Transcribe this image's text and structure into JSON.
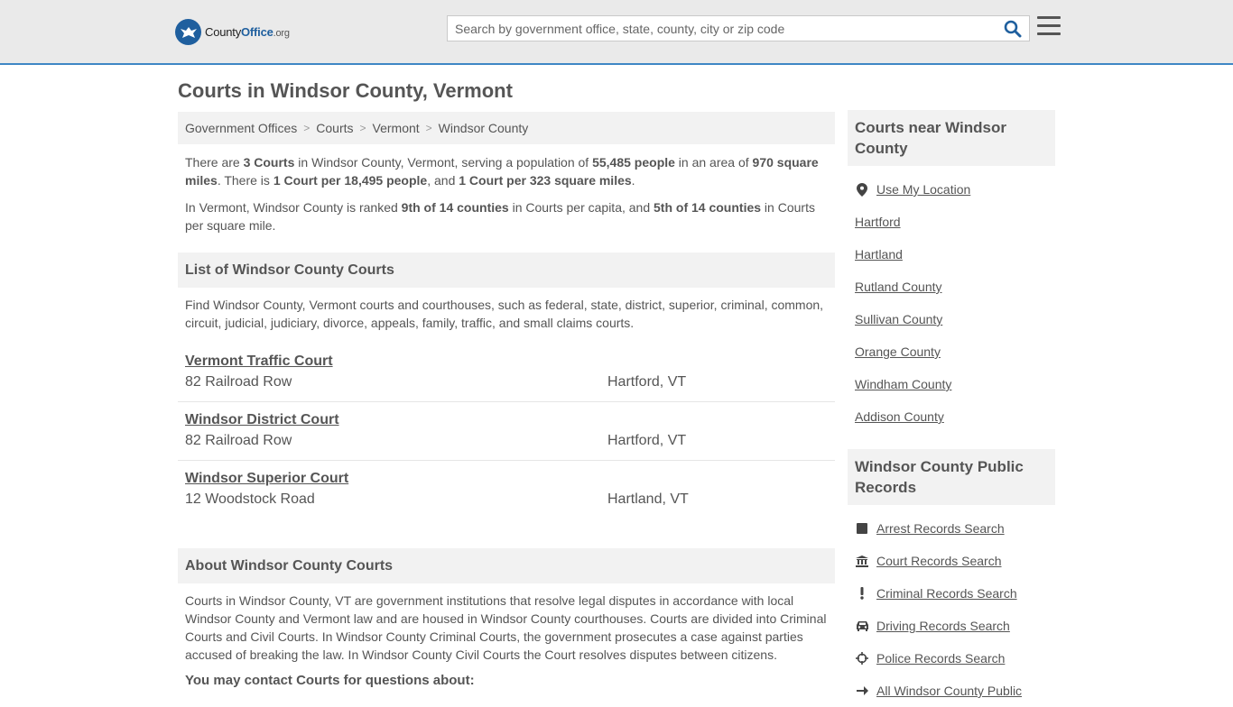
{
  "header": {
    "logo_text_a": "County",
    "logo_text_b": "Office",
    "logo_text_c": ".org",
    "search_placeholder": "Search by government office, state, county, city or zip code"
  },
  "page_title": "Courts in Windsor County, Vermont",
  "breadcrumb": [
    "Government Offices",
    "Courts",
    "Vermont",
    "Windsor County"
  ],
  "summary": {
    "p1": [
      {
        "t": "There are ",
        "b": false
      },
      {
        "t": "3 Courts",
        "b": true
      },
      {
        "t": " in Windsor County, Vermont, serving a population of ",
        "b": false
      },
      {
        "t": "55,485 people",
        "b": true
      },
      {
        "t": " in an area of ",
        "b": false
      },
      {
        "t": "970 square miles",
        "b": true
      },
      {
        "t": ". There is ",
        "b": false
      },
      {
        "t": "1 Court per 18,495 people",
        "b": true
      },
      {
        "t": ", and ",
        "b": false
      },
      {
        "t": "1 Court per 323 square miles",
        "b": true
      },
      {
        "t": ".",
        "b": false
      }
    ],
    "p2": [
      {
        "t": "In Vermont, Windsor County is ranked ",
        "b": false
      },
      {
        "t": "9th of 14 counties",
        "b": true
      },
      {
        "t": " in Courts per capita, and ",
        "b": false
      },
      {
        "t": "5th of 14 counties",
        "b": true
      },
      {
        "t": " in Courts per square mile.",
        "b": false
      }
    ]
  },
  "list_section": {
    "heading": "List of Windsor County Courts",
    "intro": "Find Windsor County, Vermont courts and courthouses, such as federal, state, district, superior, criminal, common, circuit, judicial, judiciary, divorce, appeals, family, traffic, and small claims courts."
  },
  "courts": [
    {
      "name": "Vermont Traffic Court",
      "address": "82 Railroad Row",
      "city": "Hartford, VT"
    },
    {
      "name": "Windsor District Court",
      "address": "82 Railroad Row",
      "city": "Hartford, VT"
    },
    {
      "name": "Windsor Superior Court",
      "address": "12 Woodstock Road",
      "city": "Hartland, VT"
    }
  ],
  "about_section": {
    "heading": "About Windsor County Courts",
    "text": "Courts in Windsor County, VT are government institutions that resolve legal disputes in accordance with local Windsor County and Vermont law and are housed in Windsor County courthouses. Courts are divided into Criminal Courts and Civil Courts. In Windsor County Criminal Courts, the government prosecutes a case against parties accused of breaking the law. In Windsor County Civil Courts the Court resolves disputes between citizens.",
    "contact_heading": "You may contact Courts for questions about:"
  },
  "sidebar": {
    "nearby_heading": "Courts near Windsor County",
    "use_location": "Use My Location",
    "nearby": [
      "Hartford",
      "Hartland",
      "Rutland County",
      "Sullivan County",
      "Orange County",
      "Windham County",
      "Addison County"
    ],
    "records_heading": "Windsor County Public Records",
    "records": [
      {
        "label": "Arrest Records Search",
        "icon": "square-icon"
      },
      {
        "label": "Court Records Search",
        "icon": "courthouse-icon"
      },
      {
        "label": "Criminal Records Search",
        "icon": "exclamation-icon"
      },
      {
        "label": "Driving Records Search",
        "icon": "car-icon"
      },
      {
        "label": "Police Records Search",
        "icon": "crosshair-icon"
      },
      {
        "label": "All Windsor County Public",
        "icon": "arrow-right-icon"
      }
    ]
  }
}
